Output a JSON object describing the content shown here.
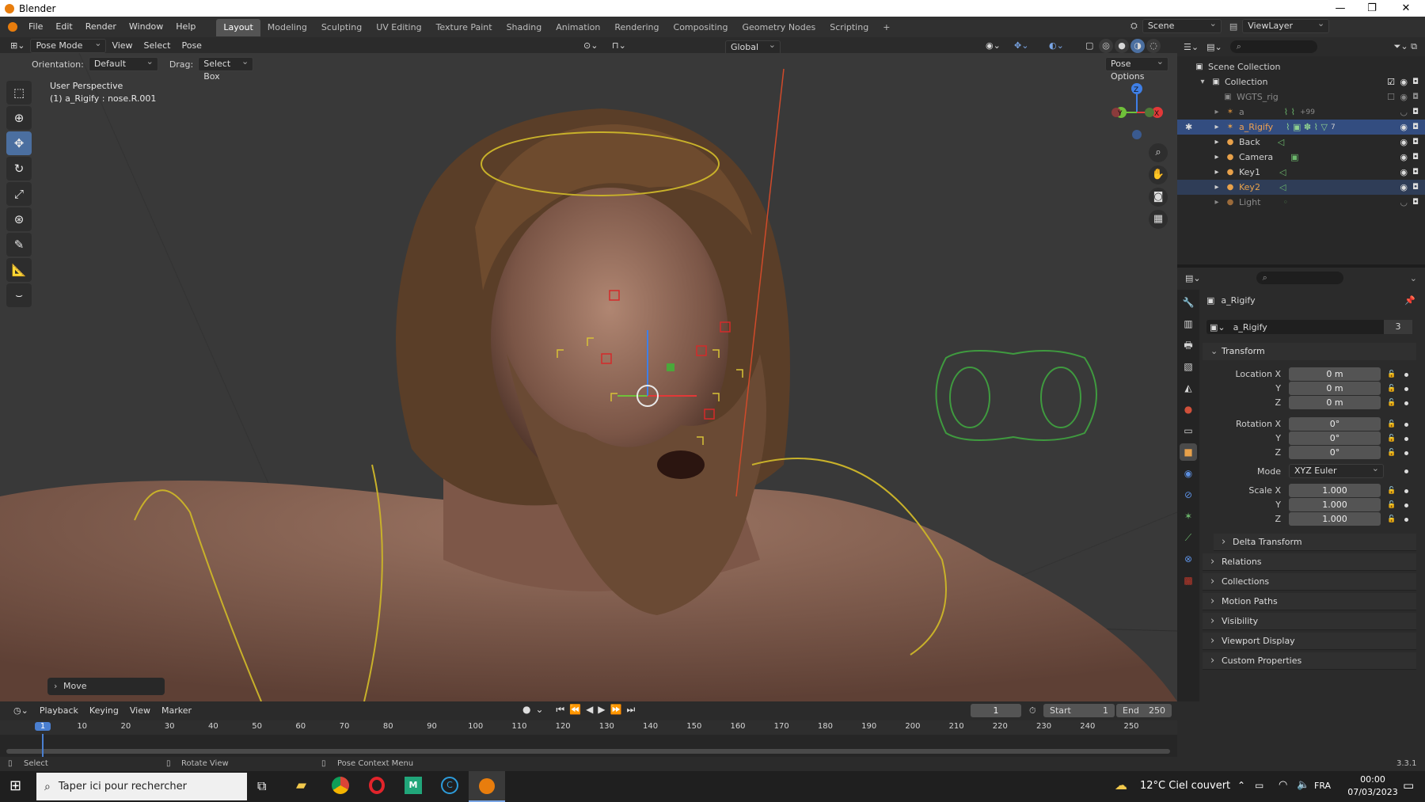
{
  "window": {
    "title": "Blender",
    "minimize": "—",
    "maximize": "❐",
    "close": "✕"
  },
  "menu": [
    "File",
    "Edit",
    "Render",
    "Window",
    "Help"
  ],
  "workspaces": [
    "Layout",
    "Modeling",
    "Sculpting",
    "UV Editing",
    "Texture Paint",
    "Shading",
    "Animation",
    "Rendering",
    "Compositing",
    "Geometry Nodes",
    "Scripting",
    "+"
  ],
  "scene": {
    "name": "Scene",
    "viewlayer": "ViewLayer"
  },
  "viewport_header": {
    "mode": "Pose Mode",
    "menus": [
      "View",
      "Select",
      "Pose"
    ],
    "orientation_label": "Orientation:",
    "orientation": "Default",
    "drag_label": "Drag:",
    "drag": "Select Box",
    "transform_orientation": "Global",
    "pose_options": "Pose Options"
  },
  "viewport": {
    "perspective": "User Perspective",
    "active": "(1) a_Rigify : nose.R.001",
    "last_op": "Move",
    "gizmo": {
      "x": "X",
      "y": "Y",
      "z": "Z"
    }
  },
  "outliner": {
    "root": "Scene Collection",
    "collection": "Collection",
    "items": [
      {
        "name": "WGTS_rig",
        "state": "dim"
      },
      {
        "name": "a",
        "state": "dim",
        "extra": "+99"
      },
      {
        "name": "a_Rigify",
        "state": "selected",
        "extra": "7"
      },
      {
        "name": "Back",
        "state": "normal"
      },
      {
        "name": "Camera",
        "state": "normal"
      },
      {
        "name": "Key1",
        "state": "normal"
      },
      {
        "name": "Key2",
        "state": "highlight"
      },
      {
        "name": "Light",
        "state": "dim"
      }
    ]
  },
  "properties": {
    "object": "a_Rigify",
    "datablock": "a_Rigify",
    "users": "3",
    "transform_title": "Transform",
    "location": {
      "label": "Location X",
      "x": "0 m",
      "y": "0 m",
      "z": "0 m"
    },
    "rotation": {
      "label": "Rotation X",
      "x": "0°",
      "y": "0°",
      "z": "0°"
    },
    "mode_label": "Mode",
    "mode": "XYZ Euler",
    "scale": {
      "label": "Scale X",
      "x": "1.000",
      "y": "1.000",
      "z": "1.000"
    },
    "axis": {
      "y": "Y",
      "z": "Z"
    },
    "delta": "Delta Transform",
    "panels": [
      "Relations",
      "Collections",
      "Motion Paths",
      "Visibility",
      "Viewport Display",
      "Custom Properties"
    ]
  },
  "timeline": {
    "menus": [
      "Playback",
      "Keying",
      "View",
      "Marker"
    ],
    "current_frame": "1",
    "start_label": "Start",
    "start": "1",
    "end_label": "End",
    "end": "250",
    "ruler": [
      "1",
      "10",
      "20",
      "30",
      "40",
      "50",
      "60",
      "70",
      "80",
      "90",
      "100",
      "110",
      "120",
      "130",
      "140",
      "150",
      "160",
      "170",
      "180",
      "190",
      "200",
      "210",
      "220",
      "230",
      "240",
      "250"
    ]
  },
  "status": {
    "select": "Select",
    "rotate": "Rotate View",
    "context": "Pose Context Menu",
    "version": "3.3.1"
  },
  "taskbar": {
    "search": "Taper ici pour rechercher",
    "weather": "12°C  Ciel couvert",
    "lang": "FRA",
    "time": "00:00",
    "date": "07/03/2023"
  }
}
